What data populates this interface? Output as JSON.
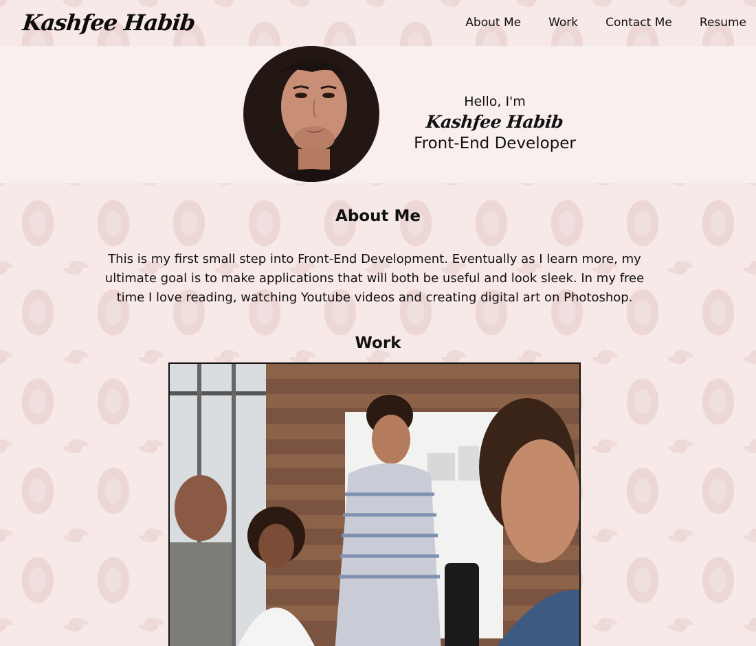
{
  "header": {
    "logo": "Kashfee Habib",
    "nav": [
      {
        "label": "About Me"
      },
      {
        "label": "Work"
      },
      {
        "label": "Contact Me"
      },
      {
        "label": "Resume"
      }
    ]
  },
  "hero": {
    "greeting": "Hello, I'm",
    "name": "Kashfee Habib",
    "role": "Front-End Developer"
  },
  "about": {
    "title": "About Me",
    "text": "This is my first small step into Front-End Development. Eventually as I learn more, my ultimate goal is to make applications that will both be useful and look sleek. In my free time I love reading, watching Youtube videos and creating digital art on Photoshop."
  },
  "work": {
    "title": "Work"
  },
  "colors": {
    "background": "#f6e9e7",
    "hero_background": "#f8efee",
    "text": "#111111"
  }
}
